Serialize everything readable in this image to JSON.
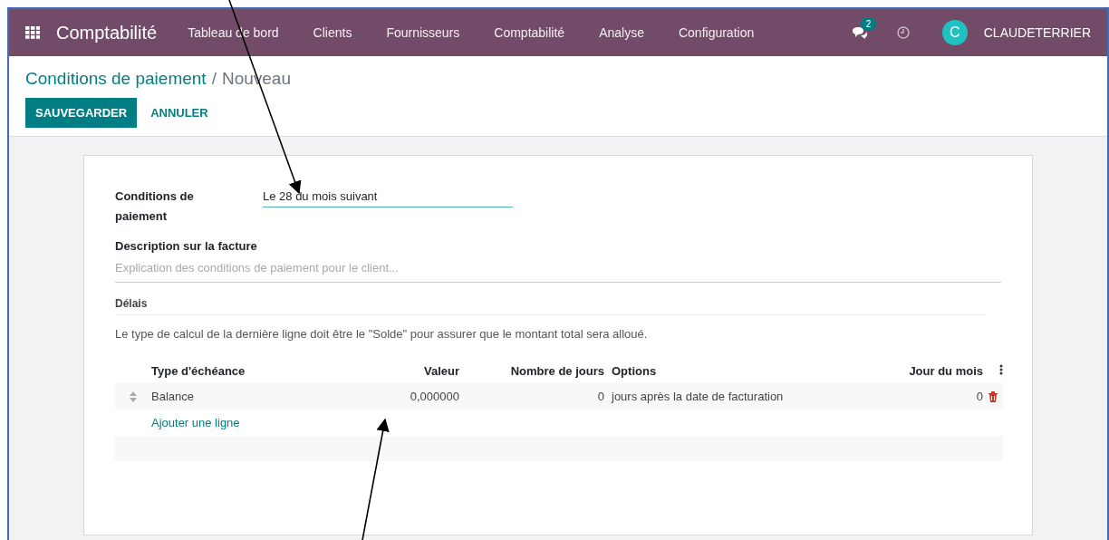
{
  "navbar": {
    "app_title": "Comptabilité",
    "menu": [
      "Tableau de bord",
      "Clients",
      "Fournisseurs",
      "Comptabilité",
      "Analyse",
      "Configuration"
    ],
    "messages_badge": "2",
    "user_initial": "C",
    "user_name": "CLAUDETERRIER"
  },
  "breadcrumb": {
    "parent": "Conditions de paiement",
    "separator": "/",
    "current": "Nouveau"
  },
  "buttons": [
    {
      "label": "SAUVEGARDER",
      "kind": "primary"
    },
    {
      "label": "ANNULER",
      "kind": "link"
    }
  ],
  "form": {
    "name_label": "Conditions de paiement",
    "name_value": "Le 28 du mois suivant",
    "description_label": "Description sur la facture",
    "description_placeholder": "Explication des conditions de paiement pour le client...",
    "section_title": "Délais",
    "note": "Le type de calcul de la dernière ligne doit être le \"Solde\" pour assurer que le montant total sera alloué."
  },
  "table": {
    "columns": [
      "Type d'échéance",
      "Valeur",
      "Nombre de jours",
      "Options",
      "Jour du mois"
    ],
    "rows": [
      [
        "Balance",
        "0,000000",
        "0",
        "jours après la date de facturation",
        "0"
      ]
    ],
    "add_line": "Ajouter une ligne"
  }
}
